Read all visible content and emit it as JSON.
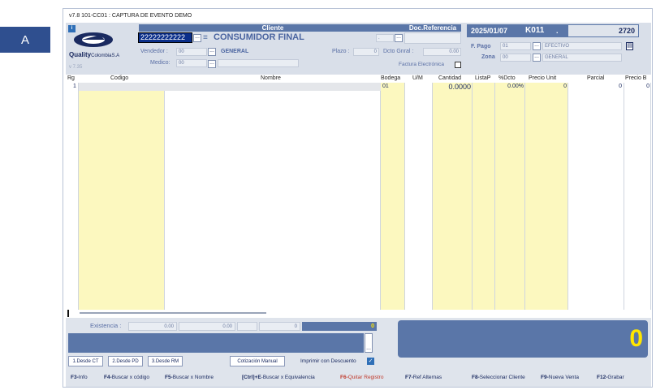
{
  "marker": "A",
  "window_title": "v7.8 101-CC01 : CAPTURA DE EVENTO DEMO",
  "logo": {
    "brand": "Quality",
    "suffix": "ColombiaS.A"
  },
  "version": "v 7.35",
  "cliente": {
    "header": "Cliente",
    "id": "22222222222",
    "name": "CONSUMIDOR FINAL",
    "group": "GENERAL",
    "code": "."
  },
  "doc_ref": {
    "header": "Doc.Referencia"
  },
  "vendedor": {
    "label": "Vendedor :",
    "value": "00"
  },
  "medico": {
    "label": "Medico:",
    "value": "00"
  },
  "plazo": {
    "label": "Plazo :",
    "value": "0"
  },
  "dcto_gnral": {
    "label": "Dcto Gnral :",
    "value": "0.00"
  },
  "factura_electronica": "Factura Electrónica",
  "doc": {
    "date": "2025/01/07",
    "code": "K011",
    "dot": ".",
    "number": "2720"
  },
  "fpago": {
    "label": "F. Pago",
    "code": "01",
    "name": "EFECTIVO"
  },
  "zona": {
    "label": "Zona",
    "code": "00",
    "name": "GENERAL"
  },
  "columns": [
    "Rg",
    "Codigo",
    "Nombre",
    "Bodega",
    "U/M",
    "Cantidad",
    "ListaP",
    "%Dcto",
    "Precio Unit",
    "Parcial",
    "Precio B"
  ],
  "rows": [
    {
      "rg": "1",
      "codigo": "",
      "nombre": "",
      "bodega": "01",
      "um": "",
      "cantidad": "0.0000",
      "listap": "",
      "dcto": "0.00%",
      "precio": "0",
      "parcial": "0",
      "preciob": "0"
    }
  ],
  "existencia": {
    "label": "Existencia :",
    "v1": "0.00",
    "v2": "0.00",
    "v3": "0",
    "v4": "0"
  },
  "total": "0",
  "buttons": {
    "desde_ct": "1.Desde CT",
    "desde_pd": "2.Desde PD",
    "desde_rm": "3.Desde RM",
    "cotizacion": "Cotización Manual",
    "imprimir": "Imprimir con Descuento"
  },
  "fkeys": [
    {
      "key": "F3-",
      "label": "Info"
    },
    {
      "key": "F4-",
      "label": "Buscar x código"
    },
    {
      "key": "F5-",
      "label": "Buscar x Nombre"
    },
    {
      "key": "[Ctrl]+E",
      "label": "-Buscar x Equivalencia"
    },
    {
      "key": "F6-",
      "label": "Quitar Registro"
    },
    {
      "key": "F7-",
      "label": "Ref Alternas"
    },
    {
      "key": "F8-",
      "label": "Seleccionar Cliente"
    },
    {
      "key": "F9-",
      "label": "Nueva Venta"
    },
    {
      "key": "F12-",
      "label": "Grabar"
    }
  ],
  "colors": {
    "accent": "#5a76a8",
    "yellow": "#fcf8bf",
    "red": "#c0392b",
    "total": "#ffe600"
  }
}
